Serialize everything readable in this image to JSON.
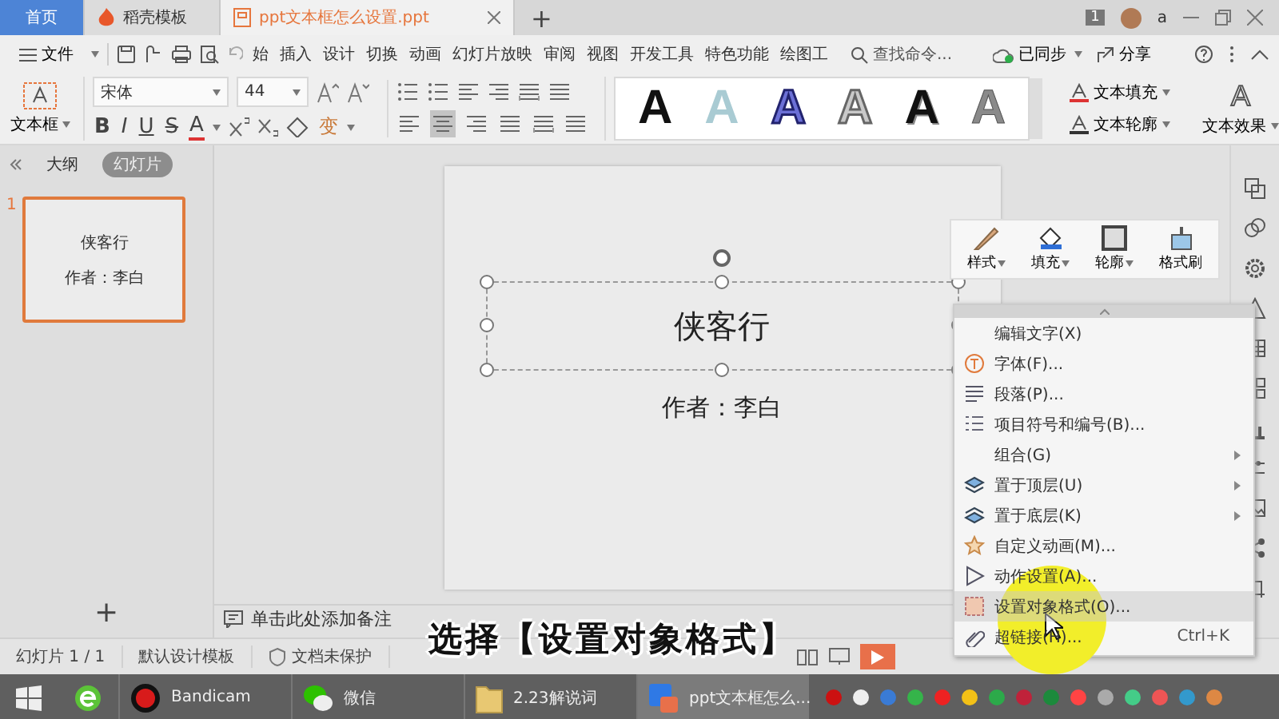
{
  "tabs": [
    {
      "label": "首页",
      "kind": "home",
      "selected": false
    },
    {
      "label": "稻壳模板",
      "kind": "docer",
      "selected": false
    },
    {
      "label": "ppt文本框怎么设置.ppt",
      "kind": "doc",
      "selected": true
    }
  ],
  "new_tab": "+",
  "title_bar": {
    "badge": "1",
    "user": "a"
  },
  "menu": {
    "file": "文件",
    "items": [
      {
        "label": "始",
        "selected": false
      },
      {
        "label": "插入",
        "selected": false
      },
      {
        "label": "设计",
        "selected": false
      },
      {
        "label": "切换",
        "selected": false
      },
      {
        "label": "动画",
        "selected": false
      },
      {
        "label": "幻灯片放映",
        "selected": false
      },
      {
        "label": "审阅",
        "selected": false
      },
      {
        "label": "视图",
        "selected": false
      },
      {
        "label": "开发工具",
        "selected": false
      },
      {
        "label": "特色功能",
        "selected": false
      },
      {
        "label": "绘图工",
        "selected": false
      }
    ],
    "search_placeholder": "查找命令...",
    "sync": "已同步",
    "share": "分享"
  },
  "ribbon": {
    "textbox": "文本框",
    "font": "宋体",
    "size": "44",
    "bold": "B",
    "italic": "I",
    "underline": "U",
    "strike": "S",
    "font_color": "A",
    "case": "变",
    "align_buttons": [
      {
        "kind": "left",
        "selected": false
      },
      {
        "kind": "center",
        "selected": true
      },
      {
        "kind": "right",
        "selected": false
      },
      {
        "kind": "justify",
        "selected": false
      },
      {
        "kind": "distributed",
        "selected": false
      }
    ],
    "wordart": [
      {
        "glyph": "A",
        "kind": "solid"
      },
      {
        "glyph": "A",
        "kind": "pale"
      },
      {
        "glyph": "A",
        "kind": "outlined"
      },
      {
        "glyph": "A",
        "kind": "hollow"
      },
      {
        "glyph": "A",
        "kind": "shadowed"
      },
      {
        "glyph": "A",
        "kind": "gradient"
      }
    ],
    "text_fill": "文本填充",
    "text_outline": "文本轮廓",
    "text_effect": "文本效果",
    "effect_glyph": "A"
  },
  "panel": {
    "tabs": [
      {
        "label": "大纲",
        "selected": false
      },
      {
        "label": "幻灯片",
        "selected": true
      }
    ],
    "slides": [
      {
        "number": "1",
        "title": "侠客行",
        "subtitle": "作者：李白",
        "selected": true
      }
    ],
    "add": "+"
  },
  "slide": {
    "title": "侠客行",
    "subtitle": "作者：李白"
  },
  "notes_placeholder": "单击此处添加备注",
  "mini_toolbar": [
    {
      "label": "样式",
      "kind": "brush",
      "dropdown": true
    },
    {
      "label": "填充",
      "kind": "bucket",
      "dropdown": true
    },
    {
      "label": "轮廓",
      "kind": "outline",
      "dropdown": true
    },
    {
      "label": "格式刷",
      "kind": "painter",
      "dropdown": false
    }
  ],
  "context_menu": [
    {
      "label": "编辑文字(X)",
      "kind": "none",
      "submenu": false,
      "selected": false
    },
    {
      "label": "字体(F)...",
      "kind": "font",
      "submenu": false,
      "selected": false
    },
    {
      "label": "段落(P)...",
      "kind": "paragraph",
      "submenu": false,
      "selected": false
    },
    {
      "label": "项目符号和编号(B)...",
      "kind": "bullets",
      "submenu": false,
      "selected": false
    },
    {
      "label": "组合(G)",
      "kind": "none",
      "submenu": true,
      "selected": false
    },
    {
      "label": "置于顶层(U)",
      "kind": "front",
      "submenu": true,
      "selected": false
    },
    {
      "label": "置于底层(K)",
      "kind": "back",
      "submenu": true,
      "selected": false
    },
    {
      "label": "自定义动画(M)...",
      "kind": "animation",
      "submenu": false,
      "selected": false
    },
    {
      "label": "动作设置(A)...",
      "kind": "action",
      "submenu": false,
      "selected": false
    },
    {
      "label": "设置对象格式(O)...",
      "kind": "format",
      "submenu": false,
      "selected": true
    },
    {
      "label": "超链接(H)...",
      "kind": "link",
      "submenu": false,
      "selected": false,
      "shortcut": "Ctrl+K"
    }
  ],
  "status_bar": {
    "slide": "幻灯片 1 / 1",
    "template": "默认设计模板",
    "protection": "文档未保护"
  },
  "caption": "选择【设置对象格式】",
  "taskbar": [
    {
      "label": "Bandicam",
      "kind": "bandicam",
      "selected": false
    },
    {
      "label": "微信",
      "kind": "wechat",
      "selected": false
    },
    {
      "label": "2.23解说词",
      "kind": "folder",
      "selected": false
    },
    {
      "label": "ppt文本框怎么...",
      "kind": "wps",
      "selected": true
    }
  ]
}
